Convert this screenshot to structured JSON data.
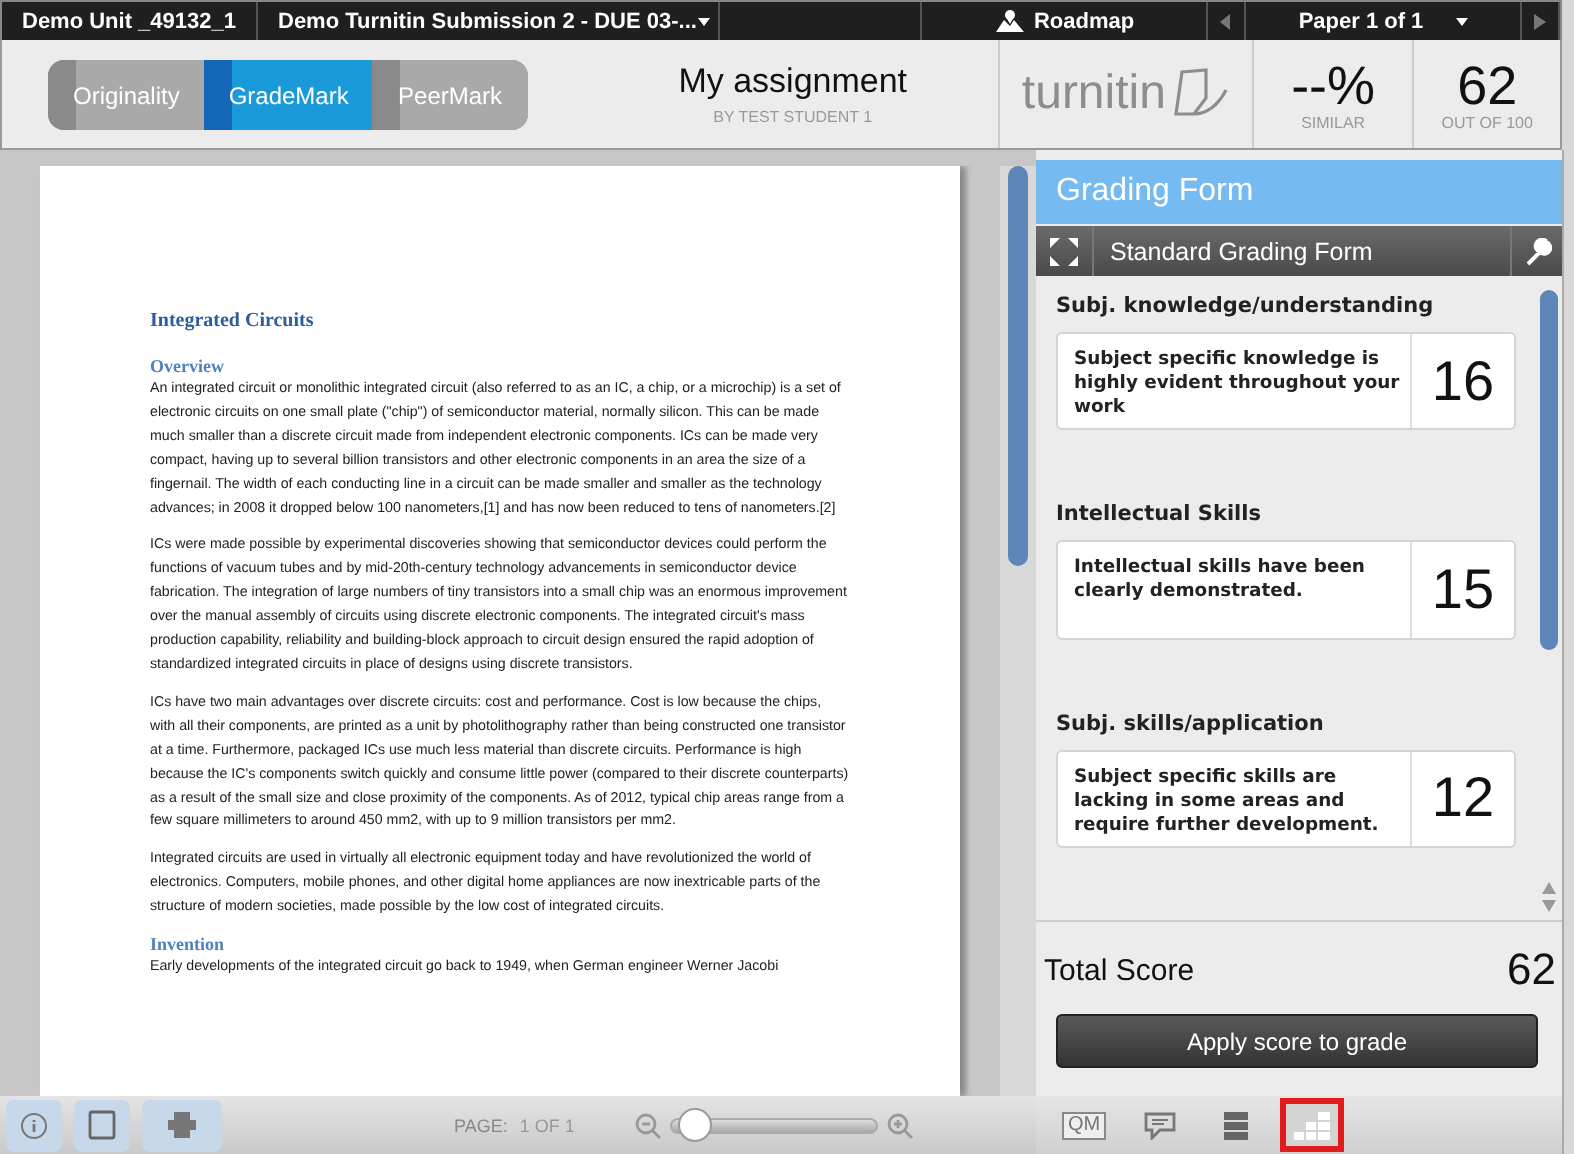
{
  "top_bar": {
    "course": "Demo Unit _49132_1",
    "assignment": "Demo Turnitin Submission 2 - DUE 03-...",
    "roadmap": "Roadmap",
    "paper": "Paper 1 of 1"
  },
  "modes": [
    {
      "label": "Originality",
      "selected": false
    },
    {
      "label": "GradeMark",
      "selected": true
    },
    {
      "label": "PeerMark",
      "selected": false
    }
  ],
  "submission": {
    "title": "My assignment",
    "author": "BY TEST STUDENT 1"
  },
  "logo": "turnitin",
  "similarity": {
    "value": "--%",
    "label": "SIMILAR"
  },
  "grade": {
    "value": "62",
    "label": "OUT OF 100"
  },
  "document": [
    {
      "kind": "heading",
      "text": "Integrated Circuits"
    },
    {
      "kind": "subheading",
      "text": "Overview"
    },
    {
      "kind": "paragraph",
      "text": "An integrated circuit or monolithic integrated circuit (also referred to as an IC, a chip, or a microchip) is a set of electronic circuits on one small plate (\"chip\") of semiconductor material, normally silicon. This can be made much smaller than a discrete circuit made from independent electronic components. ICs can be made very compact, having up to several billion transistors and other electronic components in an area the size of a fingernail. The width of each conducting line in a circuit can be made smaller and smaller as the technology advances; in 2008 it dropped below 100 nanometers,[1] and has now been reduced to tens of nanometers.[2]"
    },
    {
      "kind": "paragraph",
      "text": "ICs were made possible by experimental discoveries showing that semiconductor devices could perform the functions of vacuum tubes and by mid-20th-century technology advancements in semiconductor device fabrication. The integration of large numbers of tiny transistors into a small chip was an enormous improvement over the manual assembly of circuits using discrete electronic components. The integrated circuit's mass production capability, reliability and building-block approach to circuit design ensured the rapid adoption of standardized integrated circuits in place of designs using discrete transistors."
    },
    {
      "kind": "paragraph",
      "text": "ICs have two main advantages over discrete circuits: cost and performance. Cost is low because the chips, with all their components, are printed as a unit by photolithography rather than being constructed one transistor at a time. Furthermore, packaged ICs use much less material than discrete circuits. Performance is high because the IC's components switch quickly and consume little power (compared to their discrete counterparts) as a result of the small size and close proximity of the components. As of 2012, typical chip areas range from a few square millimeters to around 450 mm2, with up to 9 million transistors per mm2."
    },
    {
      "kind": "paragraph",
      "text": "Integrated circuits are used in virtually all electronic equipment today and have revolutionized the world of electronics. Computers, mobile phones, and other digital home appliances are now inextricable parts of the structure of modern societies, made possible by the low cost of integrated circuits."
    },
    {
      "kind": "subheading",
      "text": "Invention"
    },
    {
      "kind": "paragraph",
      "text": "Early developments of the integrated circuit go back to 1949, when German engineer Werner Jacobi"
    }
  ],
  "doc_toolbar": {
    "page_label": "PAGE:",
    "page_value": "1 OF 1",
    "zoom": {
      "level": 0.04
    }
  },
  "grading_form": {
    "title": "Grading Form",
    "form_name": "Standard Grading Form",
    "criteria": [
      {
        "name": "Subj. knowledge/understanding",
        "description": "Subject specific knowledge is highly evident throughout your work",
        "score": "16"
      },
      {
        "name": "Intellectual Skills",
        "description": "Intellectual skills have been clearly demonstrated.",
        "score": "15"
      },
      {
        "name": "Subj. skills/application",
        "description": "Subject specific skills are lacking in some areas and require further development.",
        "score": "12"
      }
    ],
    "total_label": "Total Score",
    "total": "62",
    "apply": "Apply score to grade"
  },
  "panel_tools": [
    {
      "kind": "qm",
      "label": "QM",
      "selected": false
    },
    {
      "kind": "comment",
      "selected": false
    },
    {
      "kind": "list",
      "selected": false
    },
    {
      "kind": "rubric",
      "selected": true
    }
  ]
}
